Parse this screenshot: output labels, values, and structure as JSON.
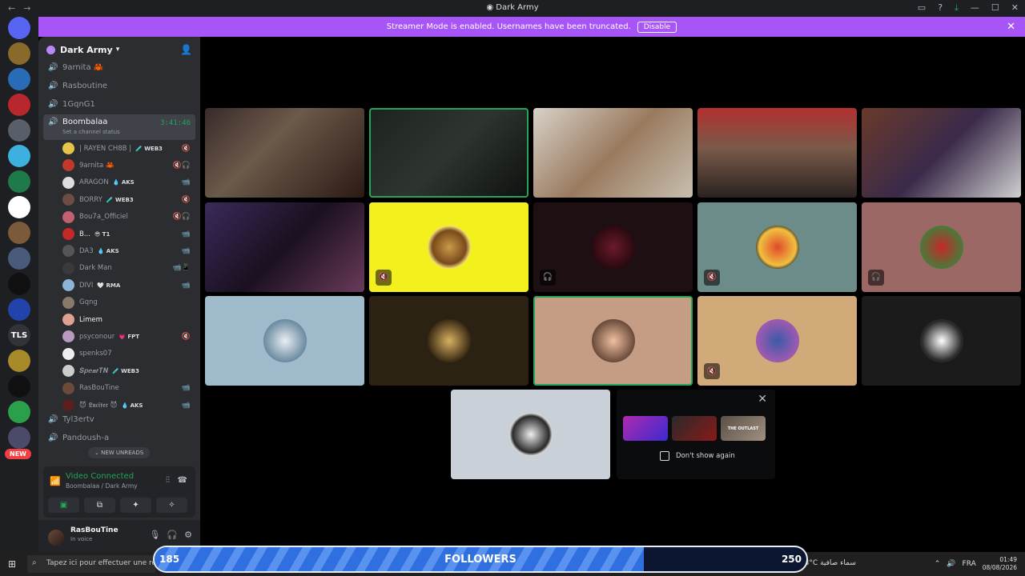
{
  "window": {
    "title": "Dark Army",
    "nav": [
      "←",
      "→"
    ],
    "controls": [
      "▭",
      "?",
      "⤓",
      "—",
      "☐",
      "✕"
    ]
  },
  "banner": {
    "text": "Streamer Mode is enabled. Usernames have been truncated.",
    "button": "Disable",
    "bg": "#a855f7"
  },
  "servers": [
    {
      "abbr": "",
      "badge": "6",
      "color": "#5865f2",
      "icon": "discord-icon"
    },
    {
      "abbr": "",
      "badge": "6",
      "color": "#8a6a2a"
    },
    {
      "abbr": "",
      "badge": "",
      "color": "#2a6bb8"
    },
    {
      "abbr": "",
      "badge": "12",
      "color": "#b8262e"
    },
    {
      "abbr": "",
      "badge": "1",
      "color": "#585e6a"
    },
    {
      "abbr": "",
      "badge": "27",
      "color": "#3db0e0"
    },
    {
      "abbr": "",
      "badge": "",
      "color": "#1f7a4a"
    },
    {
      "abbr": "",
      "badge": "1",
      "color": "#ffffff"
    },
    {
      "abbr": "",
      "badge": "13",
      "color": "#7a5a3a"
    },
    {
      "abbr": "",
      "badge": "",
      "color": "#4a5a7a"
    },
    {
      "abbr": "",
      "badge": "1",
      "color": "#111111"
    },
    {
      "abbr": "",
      "badge": "",
      "color": "#2244aa"
    },
    {
      "abbr": "TLS",
      "badge": "",
      "color": "#313338"
    },
    {
      "abbr": "",
      "badge": "315",
      "color": "#a88a2a"
    },
    {
      "abbr": "",
      "badge": "3",
      "color": "#111111"
    },
    {
      "abbr": "",
      "badge": "7",
      "color": "#2aa04a"
    },
    {
      "abbr": "",
      "badge": "",
      "color": "#4a4a6a"
    }
  ],
  "new_pill": "NEW",
  "guild": {
    "name": "Dark Army"
  },
  "channels_top": [
    "9arnita 🦀",
    "Rasboutine",
    "1GqnG1"
  ],
  "active_channel": {
    "name": "Boombalaa",
    "timer": "3:41:46",
    "status": "Set a channel status"
  },
  "voice_users": [
    {
      "name": "| RAYEN CH8B |",
      "tag": "🧪 WEB3",
      "color": "#e6c44a",
      "icon": "🔇",
      "bright": false
    },
    {
      "name": "9arnita 🦀",
      "tag": "",
      "color": "#c0392b",
      "icon": "🔇🎧",
      "bright": false
    },
    {
      "name": "ARAGON",
      "tag": "💧 AKS",
      "color": "#dddddd",
      "icon": "📹",
      "bright": false
    },
    {
      "name": "BORRY",
      "tag": "🧪 WEB3",
      "color": "#6d4c41",
      "icon": "🔇",
      "bright": false
    },
    {
      "name": "Bou7a_Officiel",
      "tag": "",
      "color": "#c06070",
      "icon": "🔇🎧",
      "bright": false
    },
    {
      "name": "B...",
      "tag": "😎 T1",
      "color": "#c62828",
      "icon": "📹",
      "bright": true
    },
    {
      "name": "DA3",
      "tag": "💧 AKS",
      "color": "#555555",
      "icon": "📹",
      "bright": false
    },
    {
      "name": "Dark Man",
      "tag": "",
      "color": "#3a3a3a",
      "icon": "📹📱",
      "bright": false
    },
    {
      "name": "DIVI",
      "tag": "🤍 RMA",
      "color": "#8db4d8",
      "icon": "📹",
      "bright": false
    },
    {
      "name": "Gqng",
      "tag": "",
      "color": "#8a7a6a",
      "icon": "",
      "bright": false
    },
    {
      "name": "Limem",
      "tag": "",
      "color": "#e0a090",
      "icon": "",
      "bright": true
    },
    {
      "name": "psyconour",
      "tag": "💗 FPT",
      "color": "#b89ac0",
      "icon": "🔇",
      "bright": false
    },
    {
      "name": "spenks07",
      "tag": "",
      "color": "#eeeeee",
      "icon": "",
      "bright": false
    },
    {
      "name": "𝑺𝒑𝒆𝒂𝒓𝑻𝑵",
      "tag": "🧪 WEB3",
      "color": "#cccccc",
      "icon": "",
      "bright": false
    },
    {
      "name": "RasBouTine",
      "tag": "",
      "color": "#6b4a3a",
      "icon": "📹",
      "bright": false
    },
    {
      "name": "😈 𝕷𝖚𝖈𝖎𝖋𝖊𝖗 😈",
      "tag": "💧 AKS",
      "color": "#5a1f1f",
      "icon": "📹",
      "bright": false
    }
  ],
  "channels_bottom": [
    "Tyl3ertv",
    "Pandoush-a"
  ],
  "unread_pill": "⌄ NEW UNREADS",
  "voice_panel": {
    "title": "Video Connected",
    "sub": "Boombalaa / Dark Army"
  },
  "user": {
    "name": "RasBouTine",
    "status": "In voice"
  },
  "tiles": [
    {
      "kind": "cam",
      "bg": "linear-gradient(135deg,#3a2a2a 0%,#6a5a4a 40%,#2a1a14 100%)",
      "speaking": false,
      "mute": ""
    },
    {
      "kind": "cam",
      "bg": "linear-gradient(135deg,#1d221f 0%,#2e3530 50%,#0e110f 100%)",
      "speaking": true,
      "mute": ""
    },
    {
      "kind": "cam",
      "bg": "linear-gradient(135deg,#d7d2c8 0%,#9a7a5e 50%,#c8bfb0 100%)",
      "speaking": false,
      "mute": ""
    },
    {
      "kind": "cam",
      "bg": "linear-gradient(180deg,#b23030 0%,#7a5a4a 45%,#2a2220 100%)",
      "speaking": false,
      "mute": ""
    },
    {
      "kind": "cam",
      "bg": "linear-gradient(135deg,#6a3a2a 0%,#3a2a4a 50%,#d0d0d0 100%)",
      "speaking": false,
      "mute": ""
    },
    {
      "kind": "cam",
      "bg": "linear-gradient(135deg,#3a2a5a 0%,#1a1020 50%,#6a3a5a 100%)",
      "speaking": false,
      "mute": ""
    },
    {
      "kind": "avatar",
      "bg": "#f3f01e",
      "avatar": "radial-gradient(circle,#c89a4a 0%,#7a4a1a 55%,#f3e07a 70%)",
      "speaking": false,
      "mute": "🔇"
    },
    {
      "kind": "avatar",
      "bg": "#1e0f12",
      "avatar": "radial-gradient(circle,#6a1a2a 0%,#2a0a10 70%)",
      "speaking": false,
      "mute": "🎧"
    },
    {
      "kind": "avatar",
      "bg": "#6c8c8a",
      "avatar": "radial-gradient(circle,#e04a2a 0%,#f0c040 60%,#2a2a2a 75%)",
      "speaking": false,
      "mute": "🔇"
    },
    {
      "kind": "avatar",
      "bg": "#9c6866",
      "avatar": "radial-gradient(circle,#c62828 0%,#4a7a3a 70%)",
      "speaking": false,
      "mute": "🎧"
    },
    {
      "kind": "avatar",
      "bg": "#9fbacb",
      "avatar": "radial-gradient(circle,#e8eef2 0%,#6a8aa0 70%)",
      "speaking": false,
      "mute": ""
    },
    {
      "kind": "avatar",
      "bg": "#2c2214",
      "avatar": "radial-gradient(circle,#d8b060 0%,#3a2a14 70%)",
      "speaking": false,
      "mute": ""
    },
    {
      "kind": "avatar",
      "bg": "#c59c84",
      "avatar": "radial-gradient(circle,#f0c0a0 0%,#6a4a3a 70%)",
      "speaking": true,
      "mute": ""
    },
    {
      "kind": "avatar",
      "bg": "#d2aa7a",
      "avatar": "radial-gradient(circle,#3a5aaa 0%,#9a5ab0 65%)",
      "speaking": false,
      "mute": "🔇"
    },
    {
      "kind": "avatar",
      "bg": "#1b1b1c",
      "avatar": "radial-gradient(circle,#ffffff 0%,#2a2a2a 65%)",
      "speaking": false,
      "mute": ""
    }
  ],
  "popup": {
    "checkbox_label": "Don't show again",
    "games": [
      {
        "label": "",
        "bg": "linear-gradient(135deg,#b02ab0,#3a2ad0)"
      },
      {
        "label": "",
        "bg": "linear-gradient(135deg,#2a2a2a,#8a1a1a)"
      },
      {
        "label": "THE OUTLAST",
        "bg": "linear-gradient(135deg,#5a5048,#a09080)"
      }
    ]
  },
  "taskbar": {
    "search": "Tapez ici pour effectuer une recherche",
    "weather": "23°C",
    "weather_text": "سماء صافية",
    "lang": "FRA",
    "time": "01:49",
    "date": "08/08/2026"
  },
  "followers": {
    "label": "FOLLOWERS",
    "min": "185",
    "max": "250",
    "progress": 0.75
  }
}
